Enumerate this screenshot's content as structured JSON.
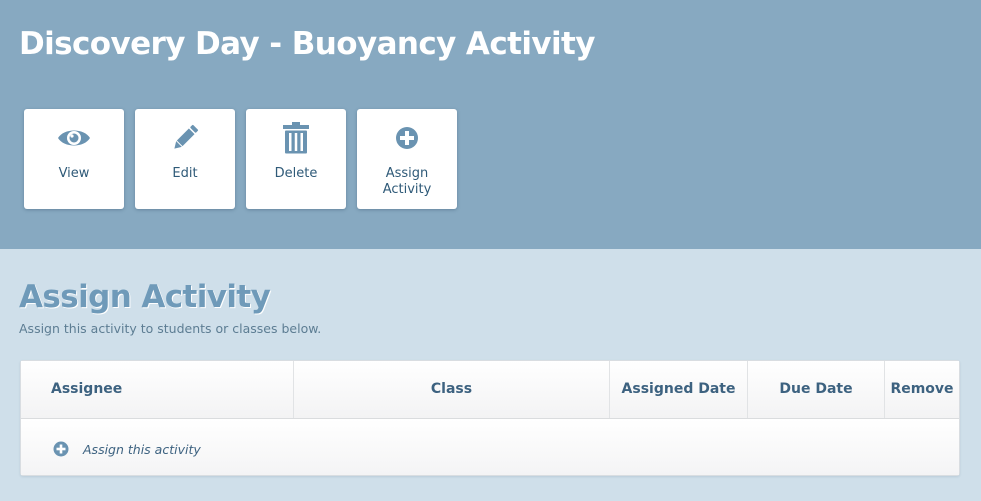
{
  "header": {
    "title": "Discovery Day - Buoyancy Activity",
    "actions": [
      {
        "label": "View",
        "icon": "eye-icon"
      },
      {
        "label": "Edit",
        "icon": "pencil-icon"
      },
      {
        "label": "Delete",
        "icon": "trash-icon"
      },
      {
        "label": "Assign\nActivity",
        "icon": "plus-circle-icon"
      }
    ]
  },
  "section": {
    "title": "Assign Activity",
    "subtitle": "Assign this activity to students or classes below."
  },
  "table": {
    "columns": [
      "Assignee",
      "Class",
      "Assigned Date",
      "Due Date",
      "Remove"
    ],
    "add_row_label": "Assign this activity"
  },
  "colors": {
    "header_bg": "#87a9c1",
    "page_bg": "#cfdfea",
    "icon": "#6a93b1",
    "text_dark": "#2f5a78"
  }
}
